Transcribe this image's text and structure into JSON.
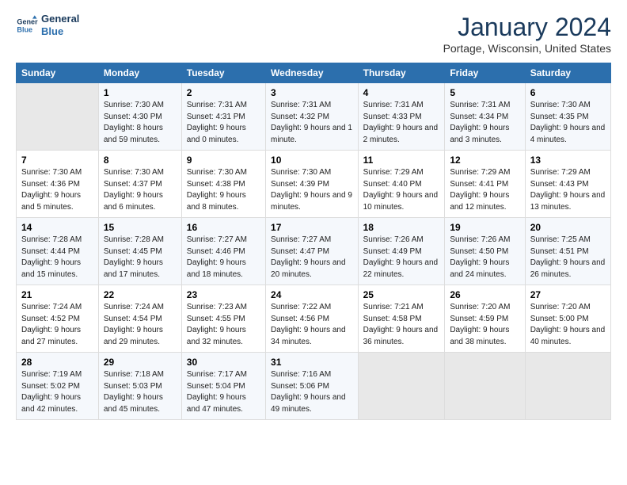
{
  "header": {
    "logo_line1": "General",
    "logo_line2": "Blue",
    "title": "January 2024",
    "subtitle": "Portage, Wisconsin, United States"
  },
  "days_of_week": [
    "Sunday",
    "Monday",
    "Tuesday",
    "Wednesday",
    "Thursday",
    "Friday",
    "Saturday"
  ],
  "weeks": [
    [
      {
        "day": "",
        "sunrise": "",
        "sunset": "",
        "daylight": "",
        "empty": true
      },
      {
        "day": "1",
        "sunrise": "7:30 AM",
        "sunset": "4:30 PM",
        "daylight": "8 hours and 59 minutes."
      },
      {
        "day": "2",
        "sunrise": "7:31 AM",
        "sunset": "4:31 PM",
        "daylight": "9 hours and 0 minutes."
      },
      {
        "day": "3",
        "sunrise": "7:31 AM",
        "sunset": "4:32 PM",
        "daylight": "9 hours and 1 minute."
      },
      {
        "day": "4",
        "sunrise": "7:31 AM",
        "sunset": "4:33 PM",
        "daylight": "9 hours and 2 minutes."
      },
      {
        "day": "5",
        "sunrise": "7:31 AM",
        "sunset": "4:34 PM",
        "daylight": "9 hours and 3 minutes."
      },
      {
        "day": "6",
        "sunrise": "7:30 AM",
        "sunset": "4:35 PM",
        "daylight": "9 hours and 4 minutes."
      }
    ],
    [
      {
        "day": "7",
        "sunrise": "7:30 AM",
        "sunset": "4:36 PM",
        "daylight": "9 hours and 5 minutes."
      },
      {
        "day": "8",
        "sunrise": "7:30 AM",
        "sunset": "4:37 PM",
        "daylight": "9 hours and 6 minutes."
      },
      {
        "day": "9",
        "sunrise": "7:30 AM",
        "sunset": "4:38 PM",
        "daylight": "9 hours and 8 minutes."
      },
      {
        "day": "10",
        "sunrise": "7:30 AM",
        "sunset": "4:39 PM",
        "daylight": "9 hours and 9 minutes."
      },
      {
        "day": "11",
        "sunrise": "7:29 AM",
        "sunset": "4:40 PM",
        "daylight": "9 hours and 10 minutes."
      },
      {
        "day": "12",
        "sunrise": "7:29 AM",
        "sunset": "4:41 PM",
        "daylight": "9 hours and 12 minutes."
      },
      {
        "day": "13",
        "sunrise": "7:29 AM",
        "sunset": "4:43 PM",
        "daylight": "9 hours and 13 minutes."
      }
    ],
    [
      {
        "day": "14",
        "sunrise": "7:28 AM",
        "sunset": "4:44 PM",
        "daylight": "9 hours and 15 minutes."
      },
      {
        "day": "15",
        "sunrise": "7:28 AM",
        "sunset": "4:45 PM",
        "daylight": "9 hours and 17 minutes."
      },
      {
        "day": "16",
        "sunrise": "7:27 AM",
        "sunset": "4:46 PM",
        "daylight": "9 hours and 18 minutes."
      },
      {
        "day": "17",
        "sunrise": "7:27 AM",
        "sunset": "4:47 PM",
        "daylight": "9 hours and 20 minutes."
      },
      {
        "day": "18",
        "sunrise": "7:26 AM",
        "sunset": "4:49 PM",
        "daylight": "9 hours and 22 minutes."
      },
      {
        "day": "19",
        "sunrise": "7:26 AM",
        "sunset": "4:50 PM",
        "daylight": "9 hours and 24 minutes."
      },
      {
        "day": "20",
        "sunrise": "7:25 AM",
        "sunset": "4:51 PM",
        "daylight": "9 hours and 26 minutes."
      }
    ],
    [
      {
        "day": "21",
        "sunrise": "7:24 AM",
        "sunset": "4:52 PM",
        "daylight": "9 hours and 27 minutes."
      },
      {
        "day": "22",
        "sunrise": "7:24 AM",
        "sunset": "4:54 PM",
        "daylight": "9 hours and 29 minutes."
      },
      {
        "day": "23",
        "sunrise": "7:23 AM",
        "sunset": "4:55 PM",
        "daylight": "9 hours and 32 minutes."
      },
      {
        "day": "24",
        "sunrise": "7:22 AM",
        "sunset": "4:56 PM",
        "daylight": "9 hours and 34 minutes."
      },
      {
        "day": "25",
        "sunrise": "7:21 AM",
        "sunset": "4:58 PM",
        "daylight": "9 hours and 36 minutes."
      },
      {
        "day": "26",
        "sunrise": "7:20 AM",
        "sunset": "4:59 PM",
        "daylight": "9 hours and 38 minutes."
      },
      {
        "day": "27",
        "sunrise": "7:20 AM",
        "sunset": "5:00 PM",
        "daylight": "9 hours and 40 minutes."
      }
    ],
    [
      {
        "day": "28",
        "sunrise": "7:19 AM",
        "sunset": "5:02 PM",
        "daylight": "9 hours and 42 minutes."
      },
      {
        "day": "29",
        "sunrise": "7:18 AM",
        "sunset": "5:03 PM",
        "daylight": "9 hours and 45 minutes."
      },
      {
        "day": "30",
        "sunrise": "7:17 AM",
        "sunset": "5:04 PM",
        "daylight": "9 hours and 47 minutes."
      },
      {
        "day": "31",
        "sunrise": "7:16 AM",
        "sunset": "5:06 PM",
        "daylight": "9 hours and 49 minutes."
      },
      {
        "day": "",
        "sunrise": "",
        "sunset": "",
        "daylight": "",
        "empty": true
      },
      {
        "day": "",
        "sunrise": "",
        "sunset": "",
        "daylight": "",
        "empty": true
      },
      {
        "day": "",
        "sunrise": "",
        "sunset": "",
        "daylight": "",
        "empty": true
      }
    ]
  ],
  "labels": {
    "sunrise_prefix": "Sunrise: ",
    "sunset_prefix": "Sunset: ",
    "daylight_prefix": "Daylight: "
  }
}
